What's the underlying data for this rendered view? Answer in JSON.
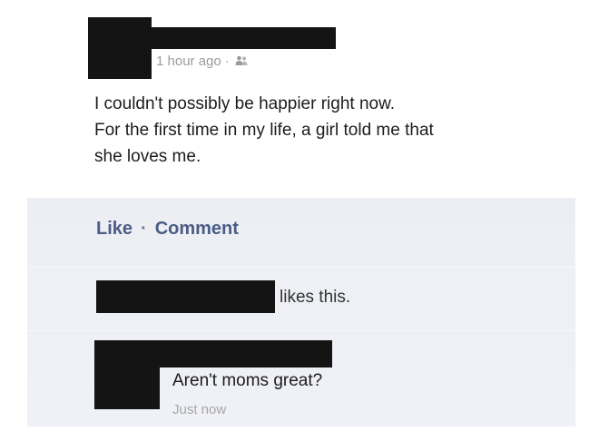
{
  "post": {
    "timestamp": "1 hour ago",
    "separator": "·",
    "audience_icon": "friends-icon",
    "text_lines": [
      "I couldn't possibly be happier right now.",
      "For the first time in my life, a girl told me that",
      "she loves me."
    ]
  },
  "actions": {
    "like_label": "Like",
    "separator": "·",
    "comment_label": "Comment"
  },
  "likes": {
    "text": "likes this."
  },
  "comment": {
    "text": "Aren't moms great?",
    "timestamp": "Just now"
  },
  "colors": {
    "link": "#4b5d85",
    "feedback_background": "#eef0f5",
    "redaction": "#141414",
    "muted_text": "#9b9b9b"
  }
}
